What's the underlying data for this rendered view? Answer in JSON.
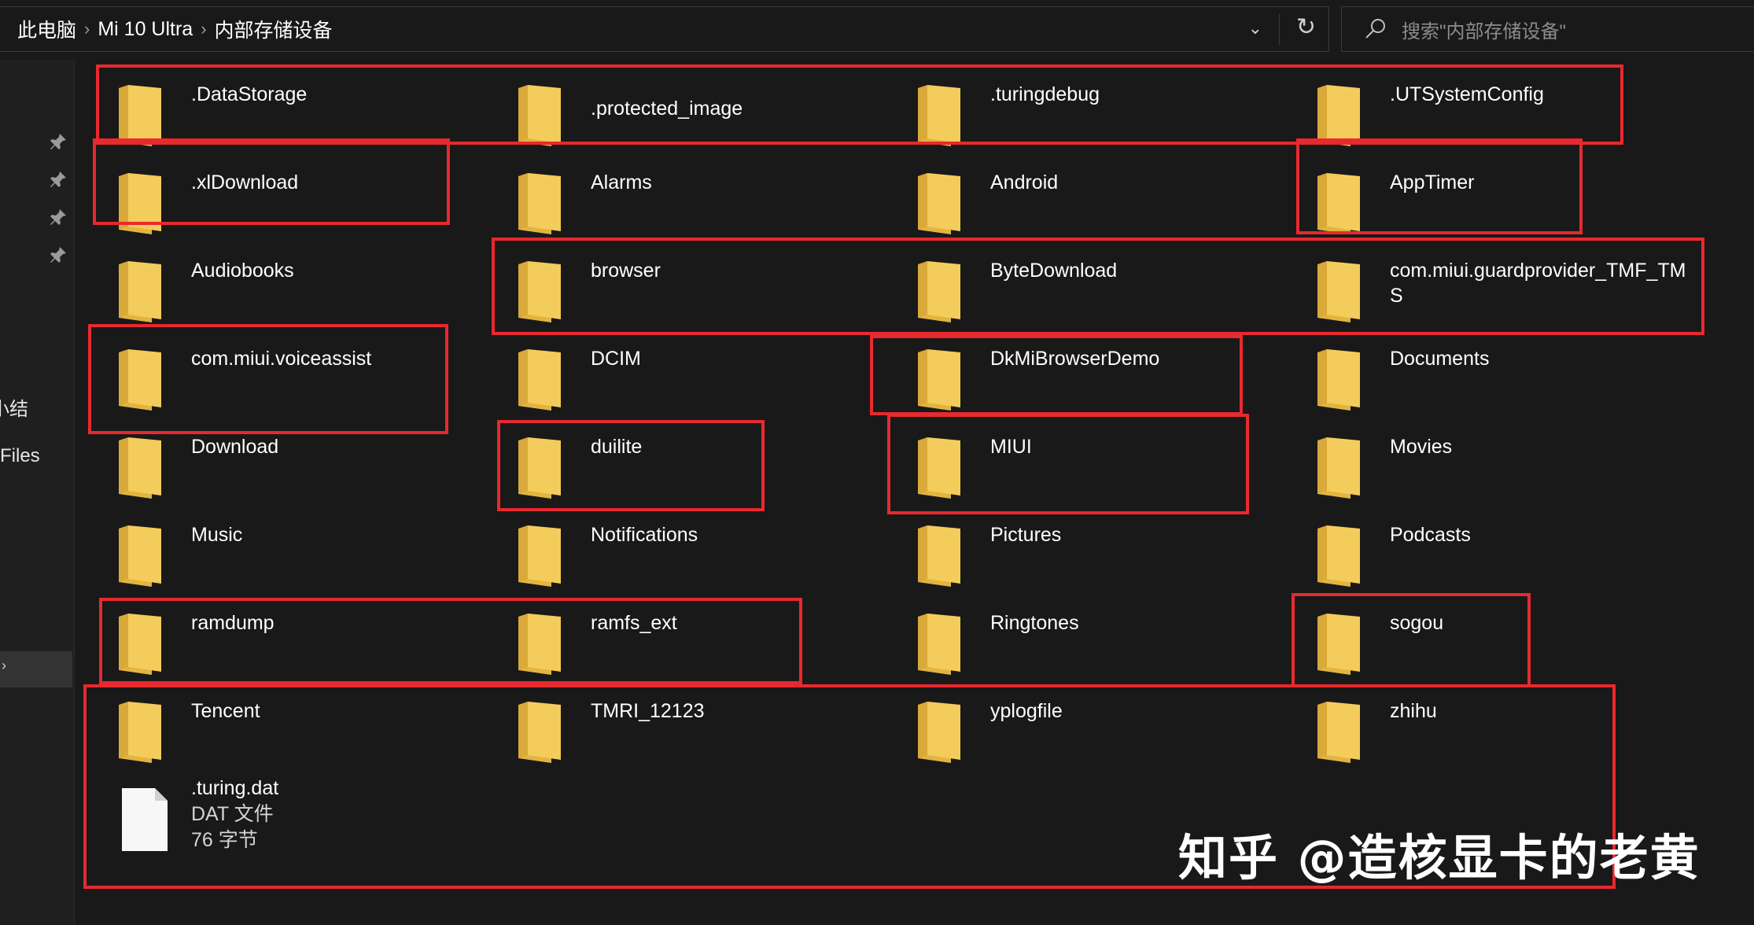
{
  "breadcrumb": [
    "此电脑",
    "Mi 10 Ultra",
    "内部存储设备"
  ],
  "search": {
    "placeholder": "搜索\"内部存储设备\""
  },
  "nav": {
    "labels": [
      "小结",
      "Files"
    ]
  },
  "items": [
    {
      "name": ".DataStorage",
      "type": "folder"
    },
    {
      "name": ".protected_image",
      "type": "folder"
    },
    {
      "name": ".turingdebug",
      "type": "folder"
    },
    {
      "name": ".UTSystemConfig",
      "type": "folder"
    },
    {
      "name": ".xlDownload",
      "type": "folder"
    },
    {
      "name": "Alarms",
      "type": "folder"
    },
    {
      "name": "Android",
      "type": "folder"
    },
    {
      "name": "AppTimer",
      "type": "folder"
    },
    {
      "name": "Audiobooks",
      "type": "folder"
    },
    {
      "name": "browser",
      "type": "folder"
    },
    {
      "name": "ByteDownload",
      "type": "folder"
    },
    {
      "name": "com.miui.guardprovider_TMF_TMS",
      "type": "folder"
    },
    {
      "name": "com.miui.voiceassist",
      "type": "folder"
    },
    {
      "name": "DCIM",
      "type": "folder"
    },
    {
      "name": "DkMiBrowserDemo",
      "type": "folder"
    },
    {
      "name": "Documents",
      "type": "folder"
    },
    {
      "name": "Download",
      "type": "folder"
    },
    {
      "name": "duilite",
      "type": "folder"
    },
    {
      "name": "MIUI",
      "type": "folder"
    },
    {
      "name": "Movies",
      "type": "folder"
    },
    {
      "name": "Music",
      "type": "folder"
    },
    {
      "name": "Notifications",
      "type": "folder"
    },
    {
      "name": "Pictures",
      "type": "folder"
    },
    {
      "name": "Podcasts",
      "type": "folder"
    },
    {
      "name": "ramdump",
      "type": "folder"
    },
    {
      "name": "ramfs_ext",
      "type": "folder"
    },
    {
      "name": "Ringtones",
      "type": "folder"
    },
    {
      "name": "sogou",
      "type": "folder"
    },
    {
      "name": "Tencent",
      "type": "folder"
    },
    {
      "name": "TMRI_12123",
      "type": "folder"
    },
    {
      "name": "yplogfile",
      "type": "folder"
    },
    {
      "name": "zhihu",
      "type": "folder"
    },
    {
      "name": ".turing.dat",
      "type": "file",
      "file_type": "DAT 文件",
      "size": "76 字节"
    }
  ],
  "watermark": "知乎 @造核显卡的老黄",
  "colors": {
    "background": "#191919",
    "highlight": "#e8292e",
    "folder": "#f4cc5c"
  }
}
